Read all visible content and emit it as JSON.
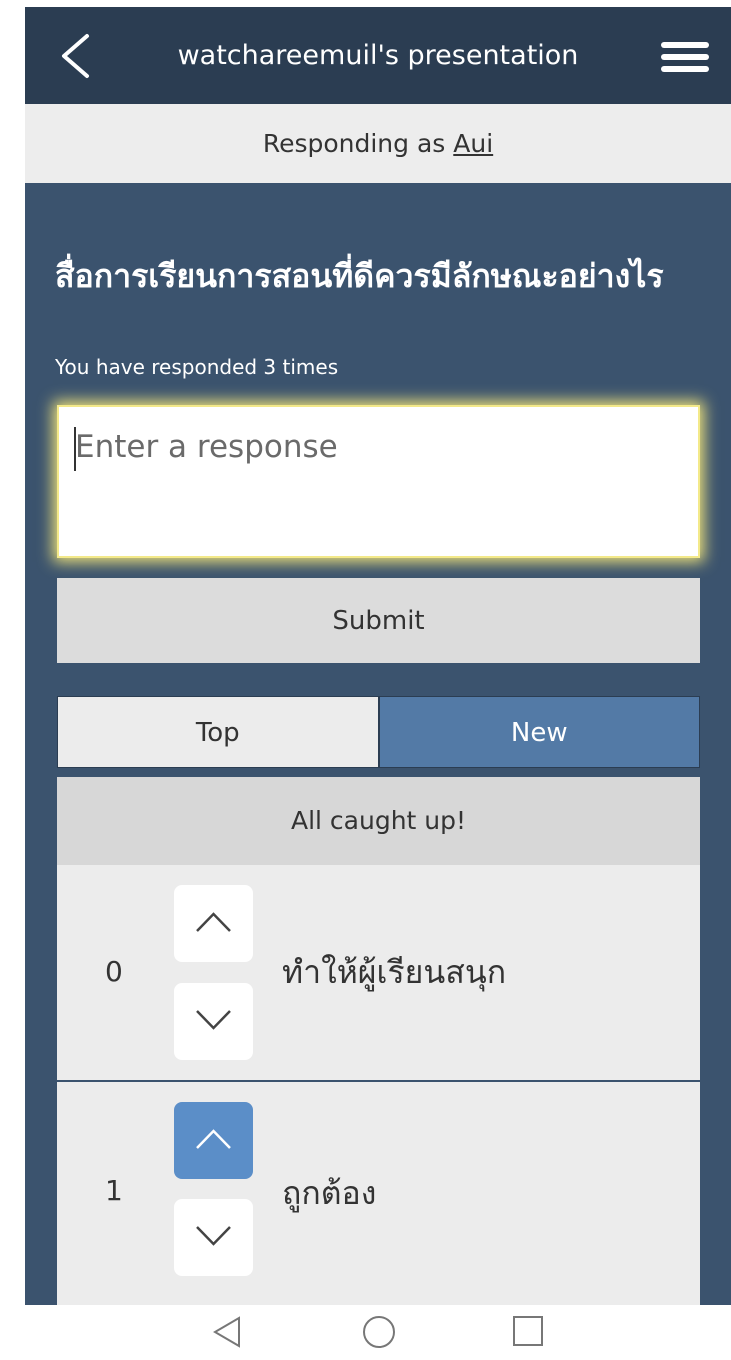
{
  "header": {
    "title": "watchareemuil's presentation",
    "back_icon": "chevron-left-icon",
    "menu_icon": "hamburger-menu-icon"
  },
  "responding": {
    "prefix": "Responding as ",
    "user": "Aui"
  },
  "question": {
    "text": "สื่อการเรียนการสอนที่ดีควรมีลักษณะอย่างไร",
    "responded_note": "You have responded 3 times"
  },
  "response_input": {
    "placeholder": "Enter a response",
    "value": ""
  },
  "submit_label": "Submit",
  "tabs": [
    {
      "label": "Top",
      "selected": false
    },
    {
      "label": "New",
      "selected": true
    }
  ],
  "status_text": "All caught up!",
  "responses": [
    {
      "votes": "0",
      "text": "ทำให้ผู้เรียนสนุก",
      "upvoted": false
    },
    {
      "votes": "1",
      "text": "ถูกต้อง",
      "upvoted": true
    }
  ],
  "colors": {
    "header_bg": "#2b3d52",
    "main_bg": "#3b536e",
    "accent": "#537aa6",
    "upvote_active": "#5b8ec8"
  },
  "system_nav": {
    "back_icon": "triangle-back-icon",
    "home_icon": "circle-home-icon",
    "recents_icon": "square-recents-icon"
  }
}
